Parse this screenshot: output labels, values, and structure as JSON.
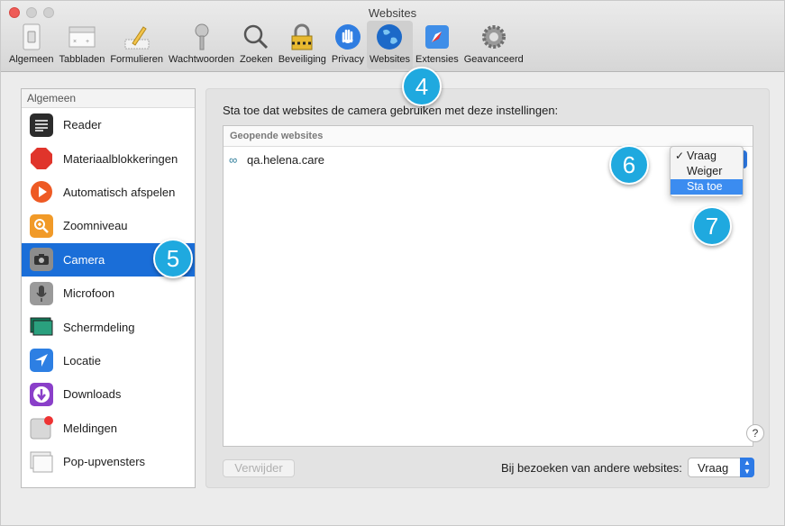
{
  "window": {
    "title": "Websites"
  },
  "toolbar": {
    "items": [
      {
        "label": "Algemeen",
        "icon": "switch-icon"
      },
      {
        "label": "Tabbladen",
        "icon": "tabs-icon"
      },
      {
        "label": "Formulieren",
        "icon": "pencil-form-icon"
      },
      {
        "label": "Wachtwoorden",
        "icon": "key-icon"
      },
      {
        "label": "Zoeken",
        "icon": "magnifier-icon"
      },
      {
        "label": "Beveiliging",
        "icon": "padlock-icon"
      },
      {
        "label": "Privacy",
        "icon": "hand-icon"
      },
      {
        "label": "Websites",
        "icon": "globe-icon"
      },
      {
        "label": "Extensies",
        "icon": "puzzle-compass-icon"
      },
      {
        "label": "Geavanceerd",
        "icon": "gear-icon"
      }
    ],
    "active_label": "Websites"
  },
  "sidebar": {
    "header": "Algemeen",
    "items": [
      {
        "label": "Reader"
      },
      {
        "label": "Materiaalblokkeringen"
      },
      {
        "label": "Automatisch afspelen"
      },
      {
        "label": "Zoomniveau"
      },
      {
        "label": "Camera"
      },
      {
        "label": "Microfoon"
      },
      {
        "label": "Schermdeling"
      },
      {
        "label": "Locatie"
      },
      {
        "label": "Downloads"
      },
      {
        "label": "Meldingen"
      },
      {
        "label": "Pop-upvensters"
      }
    ],
    "selected": "Camera"
  },
  "panel": {
    "description": "Sta toe dat websites de camera gebruiken met deze instellingen:",
    "table_header": "Geopende websites",
    "rows": [
      {
        "site": "qa.helena.care"
      }
    ],
    "dropdown": {
      "options": [
        "Vraag",
        "Weiger",
        "Sta toe"
      ],
      "checked": "Vraag",
      "highlighted": "Sta toe"
    },
    "remove_button": "Verwijder",
    "other_label": "Bij bezoeken van andere websites:",
    "other_value": "Vraag"
  },
  "help": "?",
  "badges": [
    "4",
    "5",
    "6",
    "7"
  ],
  "colors": {
    "accent": "#1a6ed8",
    "badge": "#1fa9df",
    "close": "#ee5b57"
  }
}
